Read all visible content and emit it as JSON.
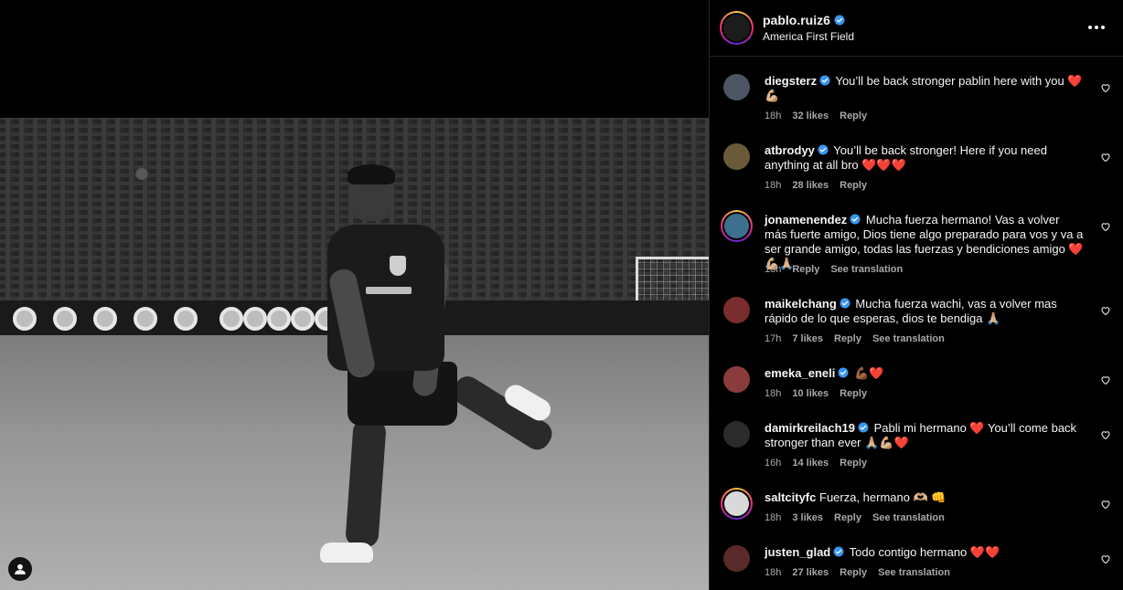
{
  "post": {
    "username": "pablo.ruiz6",
    "location": "America First Field"
  },
  "comments": [
    {
      "user": "diegsterz",
      "verified": true,
      "text": "You’ll be back stronger pablin here with you ❤️💪🏼",
      "time": "18h",
      "likes": "32 likes",
      "reply": "Reply",
      "see_translation": "",
      "avatar_color": "#4b5563",
      "ringed": false
    },
    {
      "user": "atbrodyy",
      "verified": true,
      "text": "You’ll be back stronger! Here if you need anything at all bro ❤️❤️❤️",
      "time": "18h",
      "likes": "28 likes",
      "reply": "Reply",
      "see_translation": "",
      "avatar_color": "#6b5a3a",
      "ringed": false
    },
    {
      "user": "jonamenendez",
      "verified": true,
      "text": "Mucha fuerza hermano! Vas a volver más fuerte amigo, Dios tiene algo preparado para vos y va a ser grande amigo, todas las fuerzas y bendiciones amigo ❤️💪🏼🙏🏼",
      "time": "13h",
      "likes": "",
      "reply": "Reply",
      "see_translation": "See translation",
      "avatar_color": "#3f6f8f",
      "ringed": true
    },
    {
      "user": "maikelchang",
      "verified": true,
      "text": "Mucha fuerza wachi, vas a volver mas rápido de lo que esperas, dios te bendiga 🙏🏼",
      "time": "17h",
      "likes": "7 likes",
      "reply": "Reply",
      "see_translation": "See translation",
      "avatar_color": "#7a2d2d",
      "ringed": false
    },
    {
      "user": "emeka_eneli",
      "verified": true,
      "text": "💪🏾❤️",
      "time": "18h",
      "likes": "10 likes",
      "reply": "Reply",
      "see_translation": "",
      "avatar_color": "#8a3b3b",
      "ringed": false
    },
    {
      "user": "damirkreilach19",
      "verified": true,
      "text": "Pabli mi hermano ❤️ You’ll come back stronger than ever 🙏🏼💪🏼❤️",
      "time": "16h",
      "likes": "14 likes",
      "reply": "Reply",
      "see_translation": "",
      "avatar_color": "#2b2b2b",
      "ringed": false
    },
    {
      "user": "saltcityfc",
      "verified": false,
      "text": "Fuerza, hermano 🫶🏼 👊",
      "time": "18h",
      "likes": "3 likes",
      "reply": "Reply",
      "see_translation": "See translation",
      "avatar_color": "#d9d9d9",
      "ringed": true
    },
    {
      "user": "justen_glad",
      "verified": true,
      "text": "Todo contigo hermano ❤️❤️",
      "time": "18h",
      "likes": "27 likes",
      "reply": "Reply",
      "see_translation": "See translation",
      "avatar_color": "#5a2a2a",
      "ringed": false
    }
  ],
  "icons": {
    "verified_color": "#3897f0",
    "heart": "heart-outline-icon",
    "more": "more-horizontal-icon",
    "tag": "user-tag-icon"
  }
}
